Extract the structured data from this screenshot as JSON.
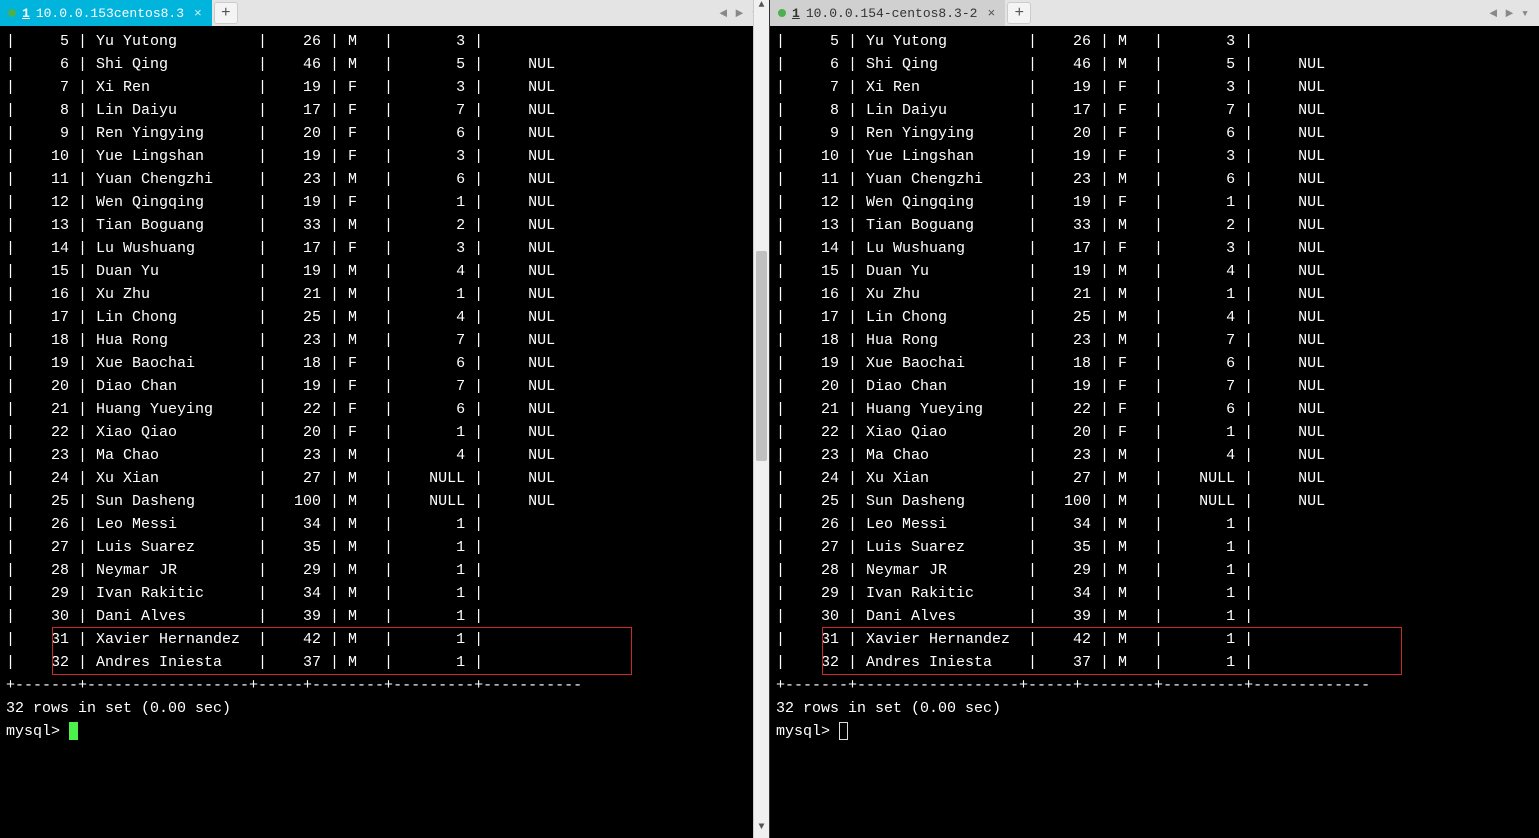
{
  "tabs": {
    "left": {
      "num": "1",
      "title": "10.0.0.153centos8.3"
    },
    "right": {
      "num": "1",
      "title": "10.0.0.154-centos8.3-2"
    }
  },
  "columns_width": {
    "id": 5,
    "name": 18,
    "age": 5,
    "gender": 3,
    "cid": 7,
    "tid": 7
  },
  "rows": [
    {
      "id": "5",
      "name": "Yu Yutong",
      "age": "26",
      "gender": "M",
      "cid": "3",
      "tid": ""
    },
    {
      "id": "6",
      "name": "Shi Qing",
      "age": "46",
      "gender": "M",
      "cid": "5",
      "tid": "NUL"
    },
    {
      "id": "7",
      "name": "Xi Ren",
      "age": "19",
      "gender": "F",
      "cid": "3",
      "tid": "NUL"
    },
    {
      "id": "8",
      "name": "Lin Daiyu",
      "age": "17",
      "gender": "F",
      "cid": "7",
      "tid": "NUL"
    },
    {
      "id": "9",
      "name": "Ren Yingying",
      "age": "20",
      "gender": "F",
      "cid": "6",
      "tid": "NUL"
    },
    {
      "id": "10",
      "name": "Yue Lingshan",
      "age": "19",
      "gender": "F",
      "cid": "3",
      "tid": "NUL"
    },
    {
      "id": "11",
      "name": "Yuan Chengzhi",
      "age": "23",
      "gender": "M",
      "cid": "6",
      "tid": "NUL"
    },
    {
      "id": "12",
      "name": "Wen Qingqing",
      "age": "19",
      "gender": "F",
      "cid": "1",
      "tid": "NUL"
    },
    {
      "id": "13",
      "name": "Tian Boguang",
      "age": "33",
      "gender": "M",
      "cid": "2",
      "tid": "NUL"
    },
    {
      "id": "14",
      "name": "Lu Wushuang",
      "age": "17",
      "gender": "F",
      "cid": "3",
      "tid": "NUL"
    },
    {
      "id": "15",
      "name": "Duan Yu",
      "age": "19",
      "gender": "M",
      "cid": "4",
      "tid": "NUL"
    },
    {
      "id": "16",
      "name": "Xu Zhu",
      "age": "21",
      "gender": "M",
      "cid": "1",
      "tid": "NUL"
    },
    {
      "id": "17",
      "name": "Lin Chong",
      "age": "25",
      "gender": "M",
      "cid": "4",
      "tid": "NUL"
    },
    {
      "id": "18",
      "name": "Hua Rong",
      "age": "23",
      "gender": "M",
      "cid": "7",
      "tid": "NUL"
    },
    {
      "id": "19",
      "name": "Xue Baochai",
      "age": "18",
      "gender": "F",
      "cid": "6",
      "tid": "NUL"
    },
    {
      "id": "20",
      "name": "Diao Chan",
      "age": "19",
      "gender": "F",
      "cid": "7",
      "tid": "NUL"
    },
    {
      "id": "21",
      "name": "Huang Yueying",
      "age": "22",
      "gender": "F",
      "cid": "6",
      "tid": "NUL"
    },
    {
      "id": "22",
      "name": "Xiao Qiao",
      "age": "20",
      "gender": "F",
      "cid": "1",
      "tid": "NUL"
    },
    {
      "id": "23",
      "name": "Ma Chao",
      "age": "23",
      "gender": "M",
      "cid": "4",
      "tid": "NUL"
    },
    {
      "id": "24",
      "name": "Xu Xian",
      "age": "27",
      "gender": "M",
      "cid": "NULL",
      "tid": "NUL"
    },
    {
      "id": "25",
      "name": "Sun Dasheng",
      "age": "100",
      "gender": "M",
      "cid": "NULL",
      "tid": "NUL"
    },
    {
      "id": "26",
      "name": "Leo Messi",
      "age": "34",
      "gender": "M",
      "cid": "1",
      "tid": ""
    },
    {
      "id": "27",
      "name": "Luis Suarez",
      "age": "35",
      "gender": "M",
      "cid": "1",
      "tid": ""
    },
    {
      "id": "28",
      "name": "Neymar JR",
      "age": "29",
      "gender": "M",
      "cid": "1",
      "tid": ""
    },
    {
      "id": "29",
      "name": "Ivan Rakitic",
      "age": "34",
      "gender": "M",
      "cid": "1",
      "tid": ""
    },
    {
      "id": "30",
      "name": "Dani Alves",
      "age": "39",
      "gender": "M",
      "cid": "1",
      "tid": ""
    },
    {
      "id": "31",
      "name": "Xavier Hernandez",
      "age": "42",
      "gender": "M",
      "cid": "1",
      "tid": "",
      "shortsep": true
    },
    {
      "id": "32",
      "name": "Andres Iniesta",
      "age": "37",
      "gender": "M",
      "cid": "1",
      "tid": "",
      "shortsep": true
    }
  ],
  "footer_sep_left": "+-------+------------------+-----+--------+---------+-----------",
  "footer_sep_right": "+-------+------------------+-----+--------+---------+-------------",
  "result_msg": "32 rows in set (0.00 sec)",
  "prompt": "mysql>",
  "highlight_rows": [
    26,
    27
  ]
}
